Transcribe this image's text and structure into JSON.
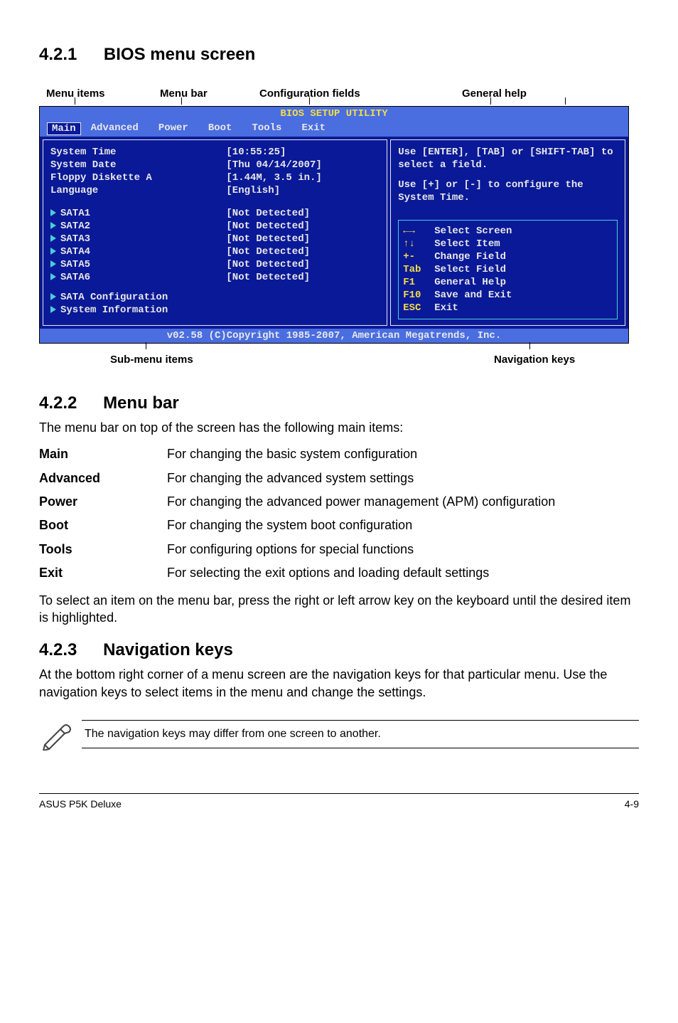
{
  "sections": {
    "s1": {
      "num": "4.2.1",
      "title": "BIOS menu screen"
    },
    "s2": {
      "num": "4.2.2",
      "title": "Menu bar"
    },
    "s3": {
      "num": "4.2.3",
      "title": "Navigation keys"
    }
  },
  "annot_top": {
    "menu_items": "Menu items",
    "menu_bar": "Menu bar",
    "config_fields": "Configuration fields",
    "general_help": "General help"
  },
  "annot_bottom": {
    "sub_menu": "Sub-menu items",
    "nav_keys": "Navigation keys"
  },
  "bios": {
    "title": "BIOS SETUP UTILITY",
    "tabs": [
      "Main",
      "Advanced",
      "Power",
      "Boot",
      "Tools",
      "Exit"
    ],
    "left_labels": {
      "r0": "System Time",
      "r1": "System Date",
      "r2": "Floppy Diskette A",
      "r3": "Language",
      "r4": "SATA1",
      "r5": "SATA2",
      "r6": "SATA3",
      "r7": "SATA4",
      "r8": "SATA5",
      "r9": "SATA6",
      "r10": "SATA Configuration",
      "r11": "System Information"
    },
    "left_values": {
      "v0": "[10:55:25]",
      "v1": "[Thu 04/14/2007]",
      "v2": "[1.44M, 3.5 in.]",
      "v3": "[English]",
      "v4": "[Not Detected]",
      "v5": "[Not Detected]",
      "v6": "[Not Detected]",
      "v7": "[Not Detected]",
      "v8": "[Not Detected]",
      "v9": "[Not Detected]"
    },
    "hint": {
      "p1": "Use [ENTER], [TAB] or [SHIFT-TAB] to select a field.",
      "p2": "Use [+] or [-] to configure the System Time."
    },
    "navkeys": [
      {
        "k": "←→",
        "l": "Select Screen"
      },
      {
        "k": "↑↓",
        "l": "Select Item"
      },
      {
        "k": "+-",
        "l": "Change Field"
      },
      {
        "k": "Tab",
        "l": "Select Field"
      },
      {
        "k": "F1",
        "l": "General Help"
      },
      {
        "k": "F10",
        "l": "Save and Exit"
      },
      {
        "k": "ESC",
        "l": "Exit"
      }
    ],
    "footer": "v02.58 (C)Copyright 1985-2007, American Megatrends, Inc."
  },
  "menubar_desc": {
    "intro": "The menu bar on top of the screen has the following main items:",
    "items": [
      {
        "term": "Main",
        "desc": "For changing the basic system configuration"
      },
      {
        "term": "Advanced",
        "desc": "For changing the advanced system settings"
      },
      {
        "term": "Power",
        "desc": "For changing the advanced power management (APM) configuration"
      },
      {
        "term": "Boot",
        "desc": "For changing the system boot configuration"
      },
      {
        "term": "Tools",
        "desc": "For configuring options for special functions"
      },
      {
        "term": "Exit",
        "desc": "For selecting the exit options and loading default settings"
      }
    ],
    "outro": "To select an item on the menu bar, press the right or left arrow key on the keyboard until the desired item is highlighted."
  },
  "navkeys_desc": "At the bottom right corner of a menu screen are the navigation keys for that particular menu. Use the navigation keys to select items in the menu and change the settings.",
  "note": "The navigation keys may differ from one screen to another.",
  "footer": {
    "left": "ASUS P5K Deluxe",
    "right": "4-9"
  }
}
